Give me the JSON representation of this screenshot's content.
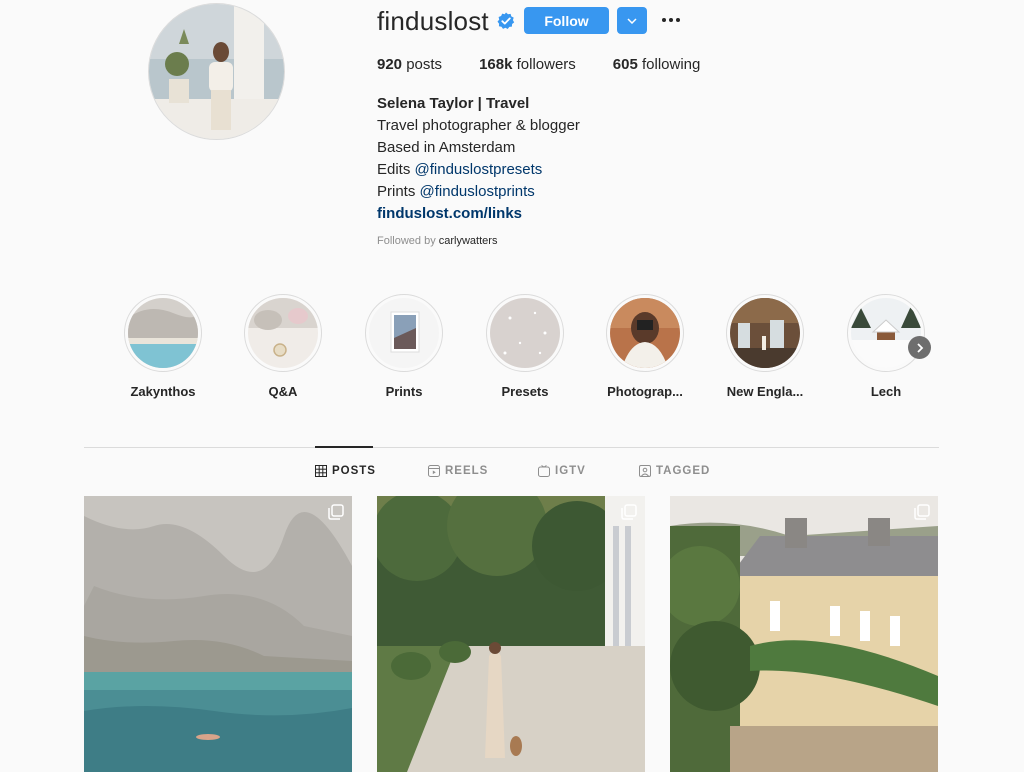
{
  "profile": {
    "username": "finduslost",
    "verified": true,
    "follow_label": "Follow",
    "stats": {
      "posts_count": "920",
      "posts_label": "posts",
      "followers_count": "168k",
      "followers_label": "followers",
      "following_count": "605",
      "following_label": "following"
    },
    "bio": {
      "name": "Selena Taylor | Travel",
      "line1": "Travel photographer & blogger",
      "line2": "Based in Amsterdam",
      "edits_prefix": "Edits ",
      "edits_mention": "@finduslostpresets",
      "prints_prefix": "Prints ",
      "prints_mention": "@finduslostprints",
      "link": "finduslost.com/links"
    },
    "followed_by_prefix": "Followed by ",
    "followed_by_user": "carlywatters"
  },
  "highlights": [
    {
      "label": "Zakynthos"
    },
    {
      "label": "Q&A"
    },
    {
      "label": "Prints"
    },
    {
      "label": "Presets"
    },
    {
      "label": "Photograp..."
    },
    {
      "label": "New Engla..."
    },
    {
      "label": "Lech"
    }
  ],
  "tabs": [
    {
      "label": "POSTS",
      "icon": "grid-icon",
      "active": true
    },
    {
      "label": "REELS",
      "icon": "reels-icon",
      "active": false
    },
    {
      "label": "IGTV",
      "icon": "igtv-icon",
      "active": false
    },
    {
      "label": "TAGGED",
      "icon": "tagged-icon",
      "active": false
    }
  ],
  "colors": {
    "accent": "#3897f0",
    "link": "#00376b",
    "verified": "#3897f0",
    "muted": "#8e8e8e"
  }
}
